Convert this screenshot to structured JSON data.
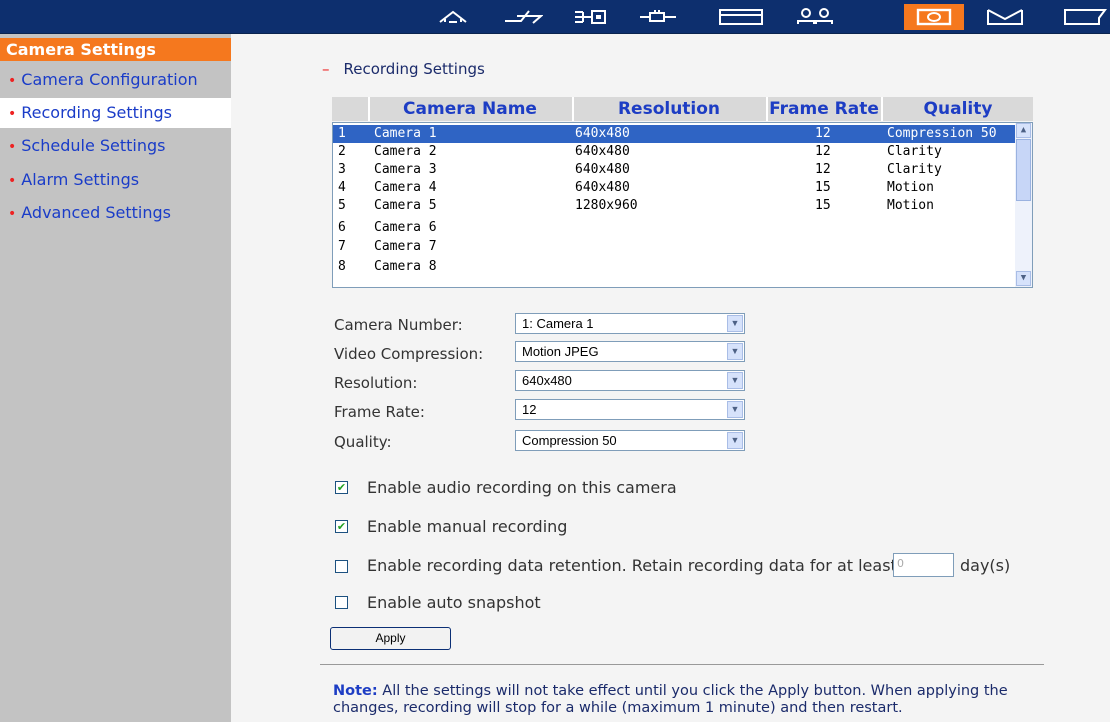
{
  "toolbar": {
    "icons": [
      "home-icon",
      "network-icon",
      "device-icon",
      "plug-icon",
      "disk-icon",
      "users-icon",
      "camera-icon",
      "mail-icon",
      "folder-icon"
    ],
    "active_icon": "camera-icon",
    "accent_color": "#f5781e",
    "bar_color": "#0d2f6e"
  },
  "sidebar": {
    "header": "Camera Settings",
    "items": [
      {
        "label": "Camera Configuration"
      },
      {
        "label": "Recording Settings"
      },
      {
        "label": "Schedule Settings"
      },
      {
        "label": "Alarm Settings"
      },
      {
        "label": "Advanced Settings"
      }
    ],
    "selected": "Recording Settings"
  },
  "main": {
    "section_title": "Recording Settings",
    "table": {
      "headers": {
        "name": "Camera Name",
        "resolution": "Resolution",
        "frame_rate": "Frame Rate",
        "quality": "Quality"
      },
      "rows": [
        {
          "num": "1",
          "name": "Camera 1",
          "resolution": "640x480",
          "frame_rate": "12",
          "quality": "Compression 50"
        },
        {
          "num": "2",
          "name": "Camera 2",
          "resolution": "640x480",
          "frame_rate": "12",
          "quality": "Clarity"
        },
        {
          "num": "3",
          "name": "Camera 3",
          "resolution": "640x480",
          "frame_rate": "12",
          "quality": "Clarity"
        },
        {
          "num": "4",
          "name": "Camera 4",
          "resolution": "640x480",
          "frame_rate": "15",
          "quality": "Motion"
        },
        {
          "num": "5",
          "name": "Camera 5",
          "resolution": "1280x960",
          "frame_rate": "15",
          "quality": "Motion"
        },
        {
          "num": "6",
          "name": "Camera 6",
          "resolution": "",
          "frame_rate": "",
          "quality": ""
        },
        {
          "num": "7",
          "name": "Camera 7",
          "resolution": "",
          "frame_rate": "",
          "quality": ""
        },
        {
          "num": "8",
          "name": "Camera 8",
          "resolution": "",
          "frame_rate": "",
          "quality": ""
        }
      ],
      "selected_row": 1
    },
    "form": {
      "camera_number": {
        "label": "Camera Number:",
        "value": "1: Camera 1"
      },
      "video_compression": {
        "label": "Video Compression:",
        "value": "Motion JPEG"
      },
      "resolution": {
        "label": "Resolution:",
        "value": "640x480"
      },
      "frame_rate": {
        "label": "Frame Rate:",
        "value": "12"
      },
      "quality": {
        "label": "Quality:",
        "value": "Compression 50"
      }
    },
    "options": {
      "audio": {
        "label": "Enable audio recording on this camera",
        "checked": true
      },
      "manual": {
        "label": "Enable manual recording",
        "checked": true
      },
      "retention": {
        "label": "Enable recording data retention. Retain recording data for at least",
        "checked": false,
        "days_value": "0",
        "days_label": "day(s)"
      },
      "snapshot": {
        "label": "Enable auto snapshot",
        "checked": false
      }
    },
    "apply_label": "Apply",
    "note": {
      "prefix": "Note:",
      "text": "All the settings will not take effect until you click the Apply button. When applying the changes, recording will stop for a while (maximum 1 minute) and then restart."
    }
  }
}
